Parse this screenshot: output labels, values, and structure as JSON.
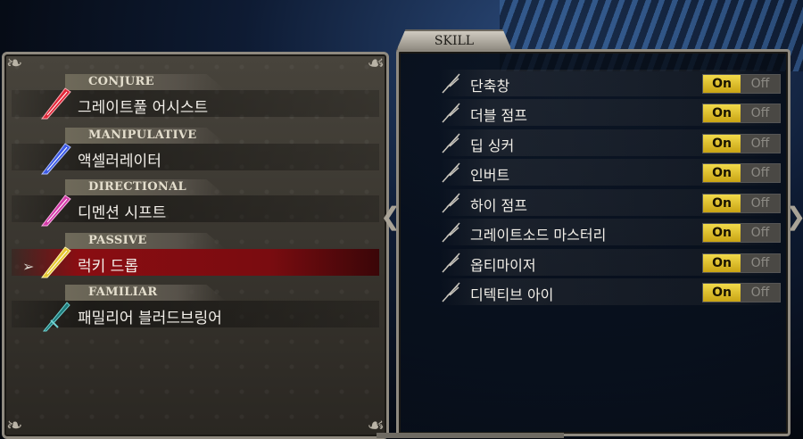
{
  "tab_label": "SKILL",
  "categories": [
    {
      "label": "CONJURE",
      "skill": "그레이트풀 어시스트",
      "gem_color": "#e0283a"
    },
    {
      "label": "MANIPULATIVE",
      "skill": "액셀러레이터",
      "gem_color": "#3c5ae6"
    },
    {
      "label": "DIRECTIONAL",
      "skill": "디멘션 시프트",
      "gem_color": "#d23ca8"
    },
    {
      "label": "PASSIVE",
      "skill": "럭키 드롭",
      "gem_color": "#e6c832"
    },
    {
      "label": "FAMILIAR",
      "skill": "패밀리어 블러드브링어",
      "gem_color": "#1e7a7a"
    }
  ],
  "selected_index": 3,
  "passive_skills": [
    {
      "name": "단축창",
      "on": "On",
      "off": "Off"
    },
    {
      "name": "더블 점프",
      "on": "On",
      "off": "Off"
    },
    {
      "name": "딥 싱커",
      "on": "On",
      "off": "Off"
    },
    {
      "name": "인버트",
      "on": "On",
      "off": "Off"
    },
    {
      "name": "하이 점프",
      "on": "On",
      "off": "Off"
    },
    {
      "name": "그레이트소드 마스터리",
      "on": "On",
      "off": "Off"
    },
    {
      "name": "옵티마이저",
      "on": "On",
      "off": "Off"
    },
    {
      "name": "디텍티브 아이",
      "on": "On",
      "off": "Off"
    }
  ],
  "icons": {
    "cursor": "selection-arrow-icon",
    "feather": "feather-quill-icon",
    "gem": "crystal-shard-icon"
  },
  "colors": {
    "accent_on": "#e6c820",
    "selected_row": "#8a0d12"
  }
}
